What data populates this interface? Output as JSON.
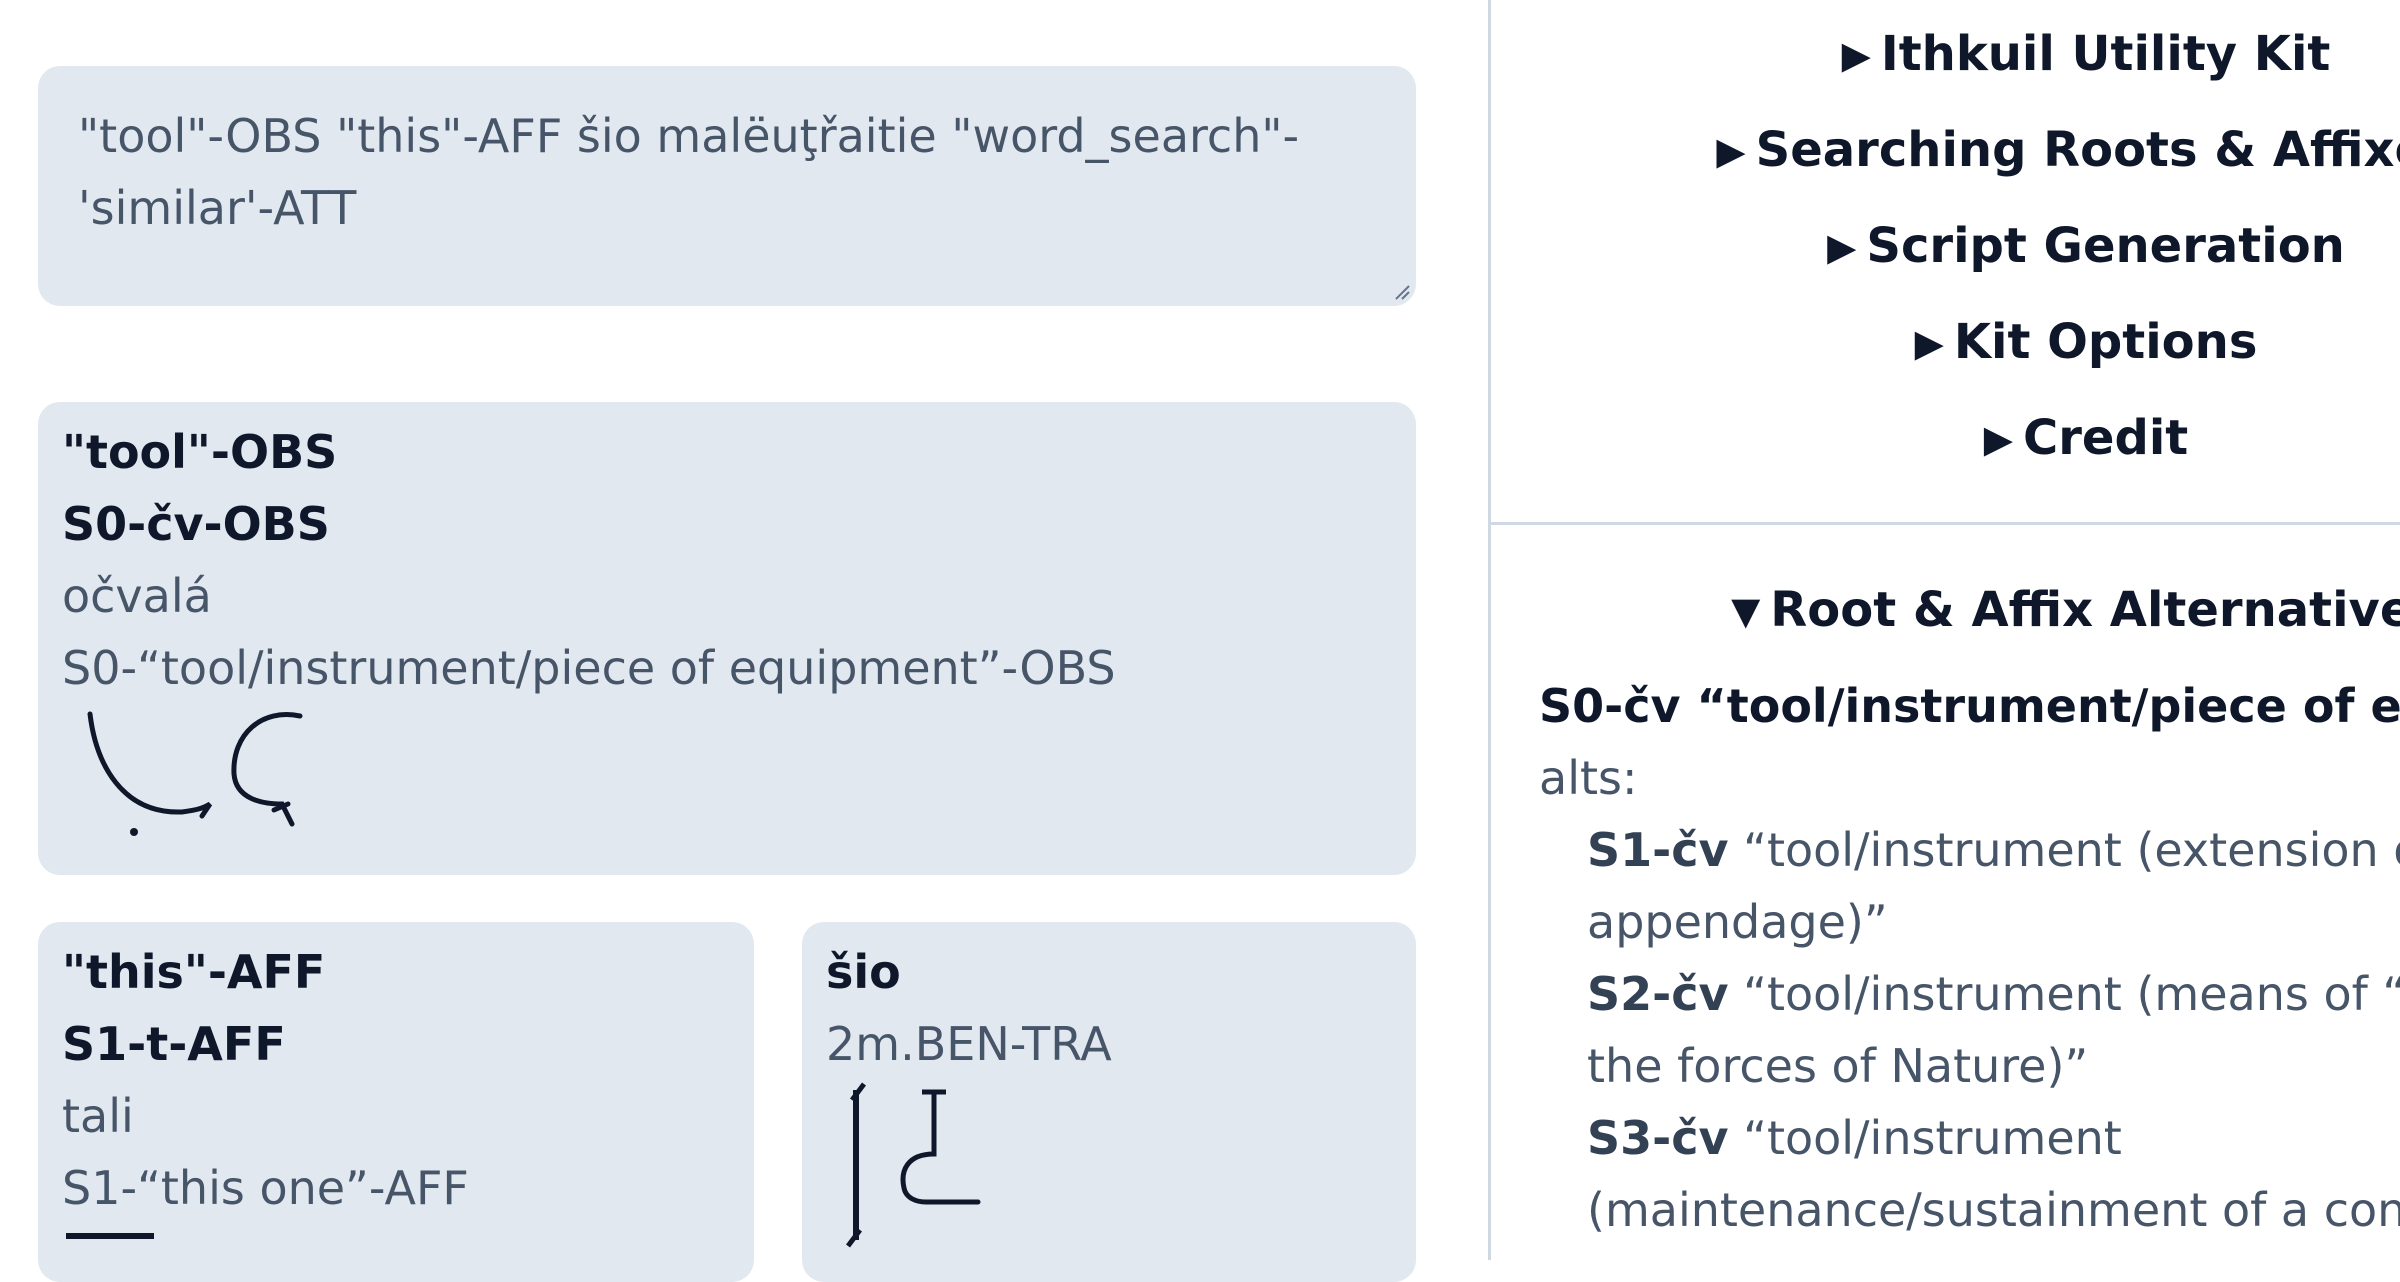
{
  "input": {
    "text": "\"tool\"-OBS \"this\"-AFF šio malëuţřaitie \"word_search\"-'similar'-ATT"
  },
  "cards": [
    {
      "title": "\"tool\"-OBS",
      "gloss": "S0-čv-OBS",
      "word": "očvalá",
      "meaning": "S0-“tool/instrument/piece of equipment”-OBS"
    },
    {
      "title": "\"this\"-AFF",
      "gloss": "S1-t-AFF",
      "word": "tali",
      "meaning": "S1-“this one”-AFF"
    },
    {
      "title": "šio",
      "gloss": "2m.BEN-TRA"
    }
  ],
  "menu": {
    "utility_kit": "Ithkuil Utility Kit",
    "searching": "Searching Roots & Affixes",
    "script": "Script Generation",
    "options": "Kit Options",
    "credit": "Credit"
  },
  "alternatives": {
    "heading": "Root & Affix Alternatives",
    "root_code": "S0-čv",
    "root_meaning": "“tool/instrument/piece of equipment”",
    "alts_label": "alts:",
    "items": [
      {
        "code": "S1-čv",
        "line1": "“tool/instrument (extension of body/",
        "line2": "appendage)”"
      },
      {
        "code": "S2-čv",
        "line1": "“tool/instrument (means of “defeating”",
        "line2": "the forces of Nature)”"
      },
      {
        "code": "S3-čv",
        "line1": "“tool/instrument",
        "line2": "(maintenance/sustainment of a construct)”"
      }
    ]
  },
  "icons": {
    "collapsed": "triangle-right-icon",
    "expanded": "triangle-down-icon"
  },
  "colors": {
    "card_bg": "#e2e8f0",
    "text_dark": "#0f172a",
    "text_muted": "#475569",
    "divider": "#cfd8e3"
  }
}
